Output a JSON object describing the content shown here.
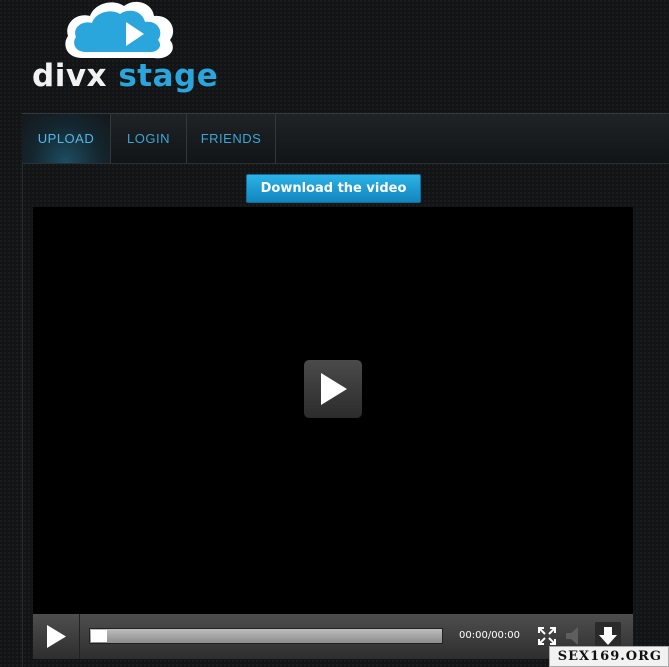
{
  "logo": {
    "word1": "divx",
    "word2": "stage"
  },
  "nav": {
    "items": [
      {
        "label": "UPLOAD",
        "active": true
      },
      {
        "label": "LOGIN",
        "active": false
      },
      {
        "label": "FRIENDS",
        "active": false
      }
    ]
  },
  "download_button": {
    "label": "Download the video"
  },
  "player": {
    "time": "00:00/00:00",
    "progress": 0
  },
  "colors": {
    "accent": "#2aa6dc",
    "background": "#121416",
    "button_top": "#2bb3e6",
    "button_bottom": "#1285bf"
  },
  "icons": [
    "play-icon",
    "fullscreen-icon",
    "volume-icon",
    "download-icon"
  ],
  "watermark": "SEX169.ORG"
}
